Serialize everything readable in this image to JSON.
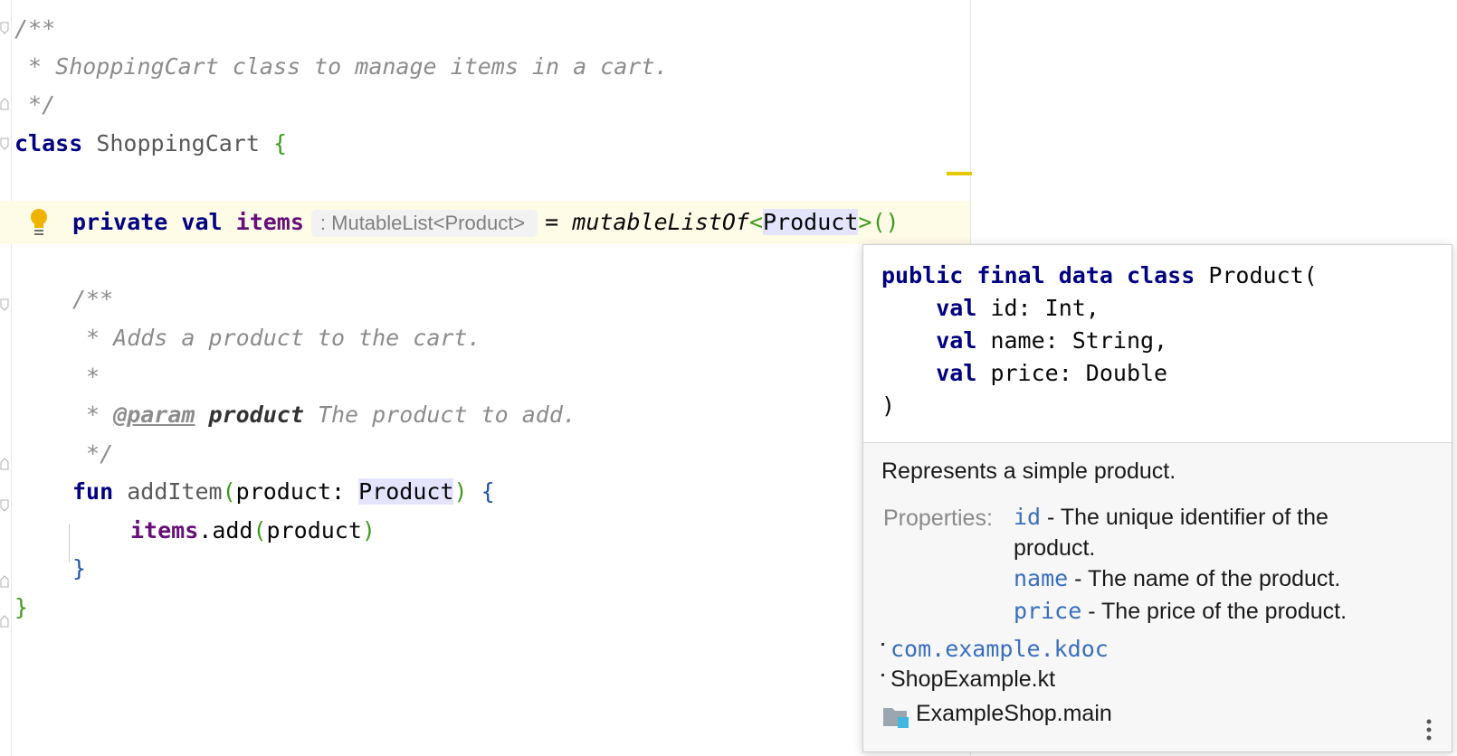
{
  "code": {
    "doc1": {
      "open": "/**",
      "body": " * ShoppingCart class to manage items in a cart.",
      "close": " */"
    },
    "class_line": {
      "keyword": "class",
      "name": "ShoppingCart",
      "brace": "{"
    },
    "items_line": {
      "private": "private",
      "val": "val",
      "name": "items",
      "type_hint": ": MutableList<Product>",
      "assign": "=",
      "call": "mutableListOf",
      "lt": "<",
      "generic": "Product",
      "gt": ">",
      "parens": "()"
    },
    "doc2": {
      "open": "/**",
      "body": " * Adds a product to the cart.",
      "blank": " *",
      "param_star": " * ",
      "param_tag": "@param",
      "param_name": "product",
      "param_desc": "The product to add.",
      "close": " */"
    },
    "fun_line": {
      "keyword": "fun",
      "name": "addItem",
      "open": "(",
      "param": "product: ",
      "type": "Product",
      "close": ")",
      "brace": "{"
    },
    "body_line": {
      "target": "items",
      "call": ".add",
      "open": "(",
      "arg": "product",
      "close": ")"
    },
    "inner_close": "}",
    "outer_close": "}"
  },
  "popup": {
    "signature": {
      "l1_public": "public",
      "l1_final": "final",
      "l1_data": "data",
      "l1_class": "class",
      "l1_rest": "Product(",
      "l2_val": "val",
      "l2_rest": "id: Int,",
      "l3_val": "val",
      "l3_rest": "name: String,",
      "l4_val": "val",
      "l4_rest": "price: Double",
      "l5": ")"
    },
    "description": "Represents a simple product.",
    "properties_label": "Properties:",
    "properties": [
      {
        "name": "id",
        "desc_1": " - The unique identifier of the",
        "desc_2": "product."
      },
      {
        "name": "name",
        "desc_1": " - The name of the product."
      },
      {
        "name": "price",
        "desc_1": " - The price of the product."
      }
    ],
    "package": "com.example.kdoc",
    "file": "ShopExample.kt",
    "module": "ExampleShop.main",
    "module_icon": "module-folder-icon",
    "more_icon": "more-vertical-icon"
  }
}
